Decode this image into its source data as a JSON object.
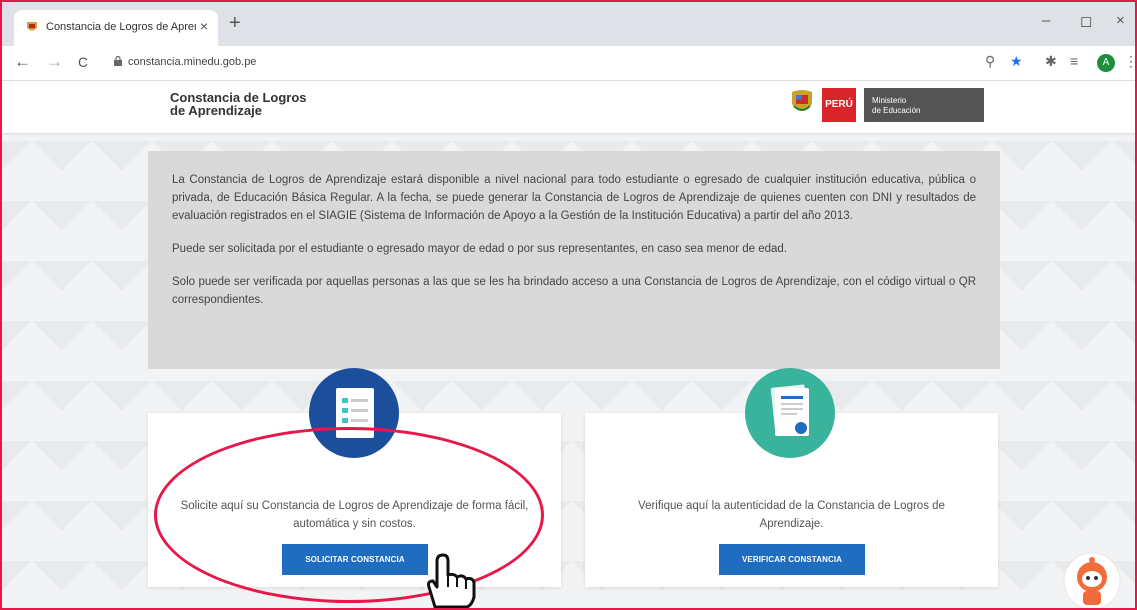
{
  "browser": {
    "tab_title": "Constancia de Logros de Aprendi",
    "tab_close": "×",
    "new_tab": "+",
    "url": "constancia.minedu.gob.pe",
    "nav": {
      "back": "←",
      "forward": "→",
      "reload": "C"
    },
    "window": {
      "minimize": "–",
      "restore": "◻",
      "close": "×"
    },
    "toolbar_icons": {
      "zoom": "⚲",
      "star": "★",
      "extensions": "✱",
      "reading_list": "≡",
      "menu": "⋮"
    },
    "avatar_letter": "A"
  },
  "site": {
    "title_line1": "Constancia de Logros",
    "title_line2": "de Aprendizaje",
    "peru_label": "PERÚ",
    "ministerio_line1": "Ministerio",
    "ministerio_line2": "de Educación"
  },
  "info": {
    "p1": "La Constancia de Logros de Aprendizaje estará disponible a nivel nacional para todo estudiante o egresado de cualquier institución educativa, pública o privada, de Educación Básica Regular. A la fecha, se puede generar la Constancia de Logros de Aprendizaje de quienes cuenten con DNI y resultados de evaluación registrados en el SIAGIE (Sistema de Información de Apoyo a la Gestión de la Institución Educativa) a partir del año 2013.",
    "p2": "Puede ser solicitada por el estudiante o egresado mayor de edad o por sus representantes, en caso sea menor de edad.",
    "p3": "Solo puede ser verificada por aquellas personas a las que se les ha brindado acceso a una Constancia de Logros de Aprendizaje, con el código virtual o QR correspondientes."
  },
  "cards": {
    "solicitar": {
      "text": "Solicite aquí su Constancia de Logros de Aprendizaje de forma fácil, automática y sin costos.",
      "button": "SOLICITAR CONSTANCIA",
      "color": "#1b4f9c"
    },
    "verificar": {
      "text": "Verifique aquí la autenticidad de la Constancia de Logros de Aprendizaje.",
      "button": "VERIFICAR CONSTANCIA",
      "color": "#39b39b"
    }
  },
  "colors": {
    "highlight": "#e8174a",
    "button": "#1f6dc1"
  }
}
